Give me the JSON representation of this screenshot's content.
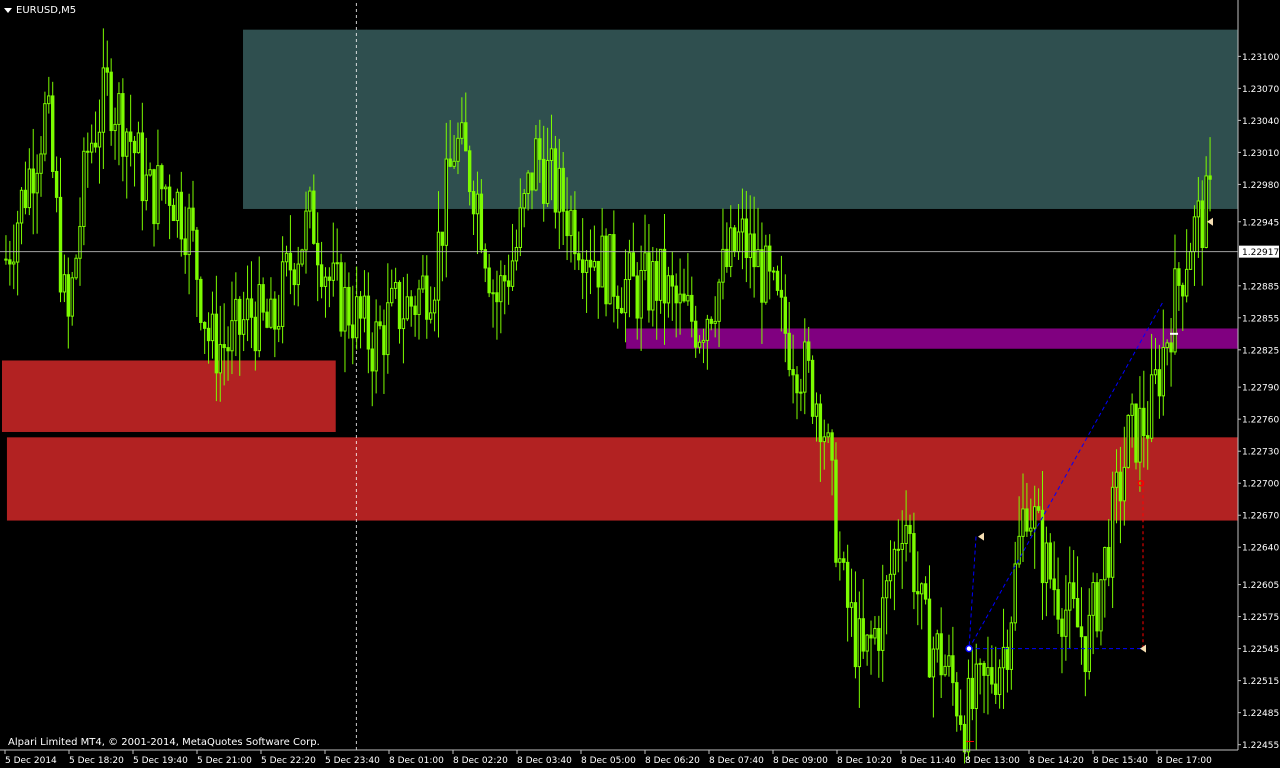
{
  "window": {
    "symbol_label": "EURUSD,M5",
    "copyright": "Alpari Limited MT4, © 2001-2014, MetaQuotes Software Corp."
  },
  "chart_data": {
    "type": "candlestick",
    "symbol": "EURUSD",
    "timeframe": "M5",
    "ylim": [
      1.2245,
      1.2315
    ],
    "y_ticks": [
      "1.23100",
      "1.23070",
      "1.23040",
      "1.23010",
      "1.22980",
      "1.22945",
      "1.22917",
      "1.22885",
      "1.22855",
      "1.22825",
      "1.22790",
      "1.22760",
      "1.22730",
      "1.22700",
      "1.22670",
      "1.22640",
      "1.22605",
      "1.22575",
      "1.22545",
      "1.22515",
      "1.22485",
      "1.22455"
    ],
    "current_price": "1.22917",
    "x_ticks": [
      "5 Dec 2014",
      "5 Dec 18:20",
      "5 Dec 19:40",
      "5 Dec 21:00",
      "5 Dec 22:20",
      "5 Dec 23:40",
      "8 Dec 01:00",
      "8 Dec 02:20",
      "8 Dec 03:40",
      "8 Dec 05:00",
      "8 Dec 06:20",
      "8 Dec 07:40",
      "8 Dec 09:00",
      "8 Dec 10:20",
      "8 Dec 11:40",
      "8 Dec 13:00",
      "8 Dec 14:20",
      "8 Dec 15:40",
      "8 Dec 17:00"
    ],
    "close_path": [
      1.2291,
      1.2298,
      1.2305,
      1.2284,
      1.2301,
      1.2307,
      1.2303,
      1.2297,
      1.2298,
      1.2294,
      1.2283,
      1.2283,
      1.2286,
      1.2284,
      1.2291,
      1.2295,
      1.2288,
      1.2286,
      1.2283,
      1.2286,
      1.2287,
      1.229,
      1.2302,
      1.2298,
      1.2287,
      1.2292,
      1.2301,
      1.2297,
      1.2294,
      1.2291,
      1.2289,
      1.2288,
      1.2289,
      1.2286,
      1.2285,
      1.2289,
      1.2293,
      1.229,
      1.2285,
      1.2281,
      1.2277,
      1.226,
      1.2253,
      1.2258,
      1.2268,
      1.2256,
      1.2253,
      1.2248,
      1.2251,
      1.2255,
      1.2269,
      1.2262,
      1.2258,
      1.2255,
      1.2264,
      1.2274,
      1.2276,
      1.2285,
      1.2293,
      1.2296
    ],
    "zones": [
      {
        "name": "supply",
        "color": "#2f4f4f",
        "y_top": 1.23125,
        "y_bottom": 1.22957,
        "x_start": 0.195,
        "x_end": 1.0
      },
      {
        "name": "magenta",
        "color": "#800080",
        "y_top": 1.22845,
        "y_bottom": 1.22826,
        "x_start": 0.505,
        "x_end": 1.0
      },
      {
        "name": "red-upper",
        "color": "#b22222",
        "y_top": 1.22815,
        "y_bottom": 1.22748,
        "x_start": 0.0,
        "x_end": 0.27
      },
      {
        "name": "red-lower",
        "color": "#b22222",
        "y_top": 1.22743,
        "y_bottom": 1.22665,
        "x_start": 0.004,
        "x_end": 1.0
      }
    ],
    "vertical_marker": {
      "x": "5 Dec 23:40",
      "style": "dashed",
      "color": "#ffffff"
    },
    "colors": {
      "background": "#000000",
      "candles": "#7cfc00",
      "axis": "#c0c0c0",
      "text": "#ffffff",
      "price_line": "#c0c0c0",
      "price_box_bg": "#ffffff",
      "price_box_text": "#000000",
      "trade_line": "#0000ff",
      "stop_line": "#ff0000",
      "entry_marker": "#f5deb3"
    }
  }
}
